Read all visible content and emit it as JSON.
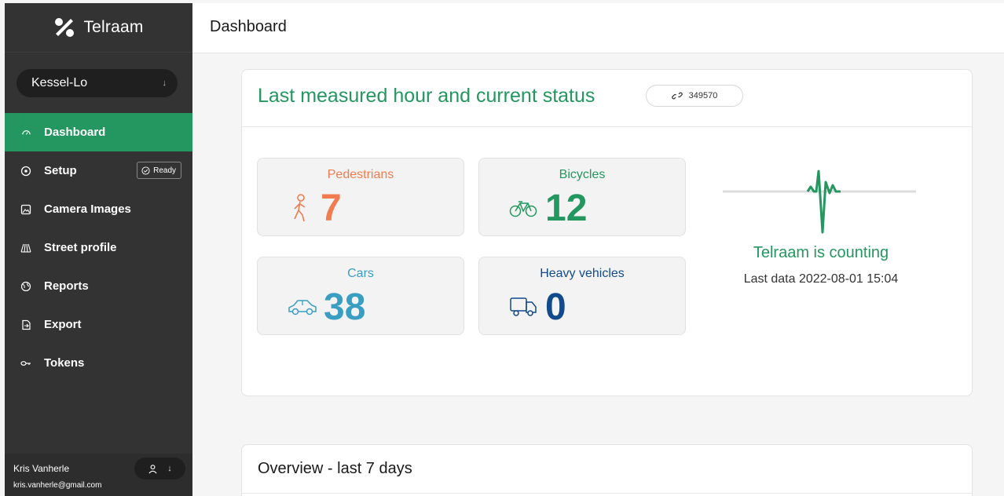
{
  "app": {
    "name": "Telraam"
  },
  "sidebar": {
    "location": "Kessel-Lo",
    "items": [
      {
        "label": "Dashboard",
        "icon": "gauge-icon",
        "active": true
      },
      {
        "label": "Setup",
        "icon": "target-icon",
        "badge": "Ready"
      },
      {
        "label": "Camera Images",
        "icon": "image-icon"
      },
      {
        "label": "Street profile",
        "icon": "street-icon"
      },
      {
        "label": "Reports",
        "icon": "globe-icon"
      },
      {
        "label": "Export",
        "icon": "export-icon"
      },
      {
        "label": "Tokens",
        "icon": "key-icon"
      }
    ],
    "user": {
      "name": "Kris Vanherle",
      "email": "kris.vanherle@gmail.com"
    }
  },
  "header": {
    "title": "Dashboard"
  },
  "status_card": {
    "title": "Last measured hour and current status",
    "segment_id": "349570",
    "tiles": [
      {
        "label": "Pedestrians",
        "value": "7",
        "color": "#f07c50"
      },
      {
        "label": "Bicycles",
        "value": "12",
        "color": "#23975f"
      },
      {
        "label": "Cars",
        "value": "38",
        "color": "#3a9ec2"
      },
      {
        "label": "Heavy vehicles",
        "value": "0",
        "color": "#124a8b"
      }
    ],
    "status": "Telraam is counting",
    "last_data": "Last data 2022-08-01 15:04"
  },
  "overview_card": {
    "title": "Overview - last 7 days"
  },
  "colors": {
    "sidebar": "#333333",
    "accent": "#23975f"
  }
}
